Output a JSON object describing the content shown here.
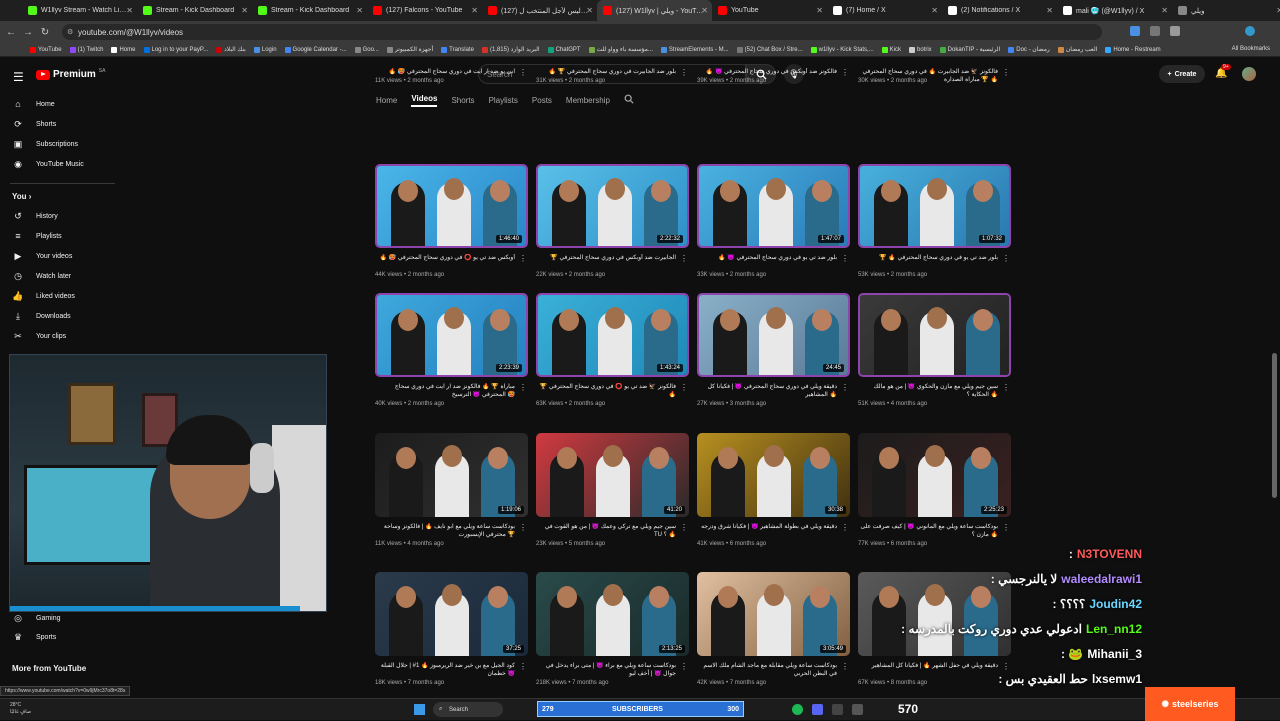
{
  "browser": {
    "tabs": [
      {
        "title": "W1llyv Stream - Watch Live c",
        "color": "#53fc18"
      },
      {
        "title": "Stream - Kick Dashboard",
        "color": "#53fc18"
      },
      {
        "title": "Stream - Kick Dashboard",
        "color": "#53fc18"
      },
      {
        "title": "(127) Falcons - YouTube",
        "color": "#ff0000"
      },
      {
        "title": "(127) كواليس لأجل المنتخب ل",
        "color": "#ff0000"
      },
      {
        "title": "(127) W1llyv | ويلي - YouTube",
        "color": "#ff0000"
      },
      {
        "title": "YouTube",
        "color": "#ff0000"
      },
      {
        "title": "(7) Home / X",
        "color": "#ffffff"
      },
      {
        "title": "(2) Notifications / X",
        "color": "#ffffff"
      },
      {
        "title": "mali 🥶 (@W1llyv) / X",
        "color": "#ffffff"
      },
      {
        "title": "ويلي",
        "color": "#888888"
      }
    ],
    "url": "youtube.com/@W1llyv/videos",
    "bookmarks": [
      "YouTube",
      "(1) Twitch",
      "Home",
      "Log in to your PayP...",
      "بنك البلاد",
      "Login",
      "Google Calendar -...",
      "Goo...",
      "أجهزة الكمبيوتر",
      "Translate",
      "البريد الوارد (1,815)",
      "ChatGPT",
      "مؤسسة باء وواو للت...",
      "StreamElements - M...",
      "(52) Chat Box / Stre...",
      "w1llyv - Kick Stats,...",
      "Kick",
      "botrix",
      "DokanTIP - الرئيسية",
      "Doc - رمضان",
      "العب رمضان",
      "Home - Restream"
    ],
    "all_bookmarks": "All Bookmarks"
  },
  "yt": {
    "logo": "Premium",
    "logo_region": "SA",
    "search_placeholder": "Search",
    "create": "Create",
    "notif_count": "9+"
  },
  "sidebar": {
    "items": [
      {
        "label": "Home",
        "icon": "⌂"
      },
      {
        "label": "Shorts",
        "icon": "⟳"
      },
      {
        "label": "Subscriptions",
        "icon": "▣"
      },
      {
        "label": "YouTube Music",
        "icon": "◉"
      }
    ],
    "you": "You",
    "you_items": [
      {
        "label": "History",
        "icon": "↺"
      },
      {
        "label": "Playlists",
        "icon": "≡"
      },
      {
        "label": "Your videos",
        "icon": "▶"
      },
      {
        "label": "Watch later",
        "icon": "◷"
      },
      {
        "label": "Liked videos",
        "icon": "👍"
      },
      {
        "label": "Downloads",
        "icon": "⤓"
      },
      {
        "label": "Your clips",
        "icon": "✂"
      }
    ],
    "explore_items": [
      {
        "label": "Gaming",
        "icon": "🎮"
      },
      {
        "label": "Sports",
        "icon": "🏆"
      }
    ],
    "more_from_youtube": "More from YouTube"
  },
  "channel_tabs": [
    "Home",
    "Videos",
    "Shorts",
    "Playlists",
    "Posts",
    "Membership"
  ],
  "videos": [
    {
      "title": "🔥 🥵 ابي يو ضد ار ايت في دوري سحاج المحترفي",
      "meta": "11K views • 2 months ago"
    },
    {
      "title": "🔥 🏆 بلور ضد الجابيرت في دوري سحاج المحترفي",
      "meta": "31K views • 2 months ago"
    },
    {
      "title": "🔥 😈 فالكونز ضد أوبكس في دوري سحاج المحترفي",
      "meta": "39K views • 2 months ago"
    },
    {
      "title": "فالكونز 🦅 ضد الجابيرت 🔥 في دوري سحاج المحترفي 🏆 مباراة الصدارة 🔥",
      "meta": "30K views • 2 months ago"
    },
    {
      "title": "🔥 🥵 أوبكس ضد تي يو ⭕ في دوري سحاج المحترفي",
      "meta": "44K views • 2 months ago",
      "dur": "1:46:40"
    },
    {
      "title": "🏆 الجابيرت ضد أوبكس في دوري سحاج المحترفي",
      "meta": "22K views • 2 months ago",
      "dur": "2:22:32"
    },
    {
      "title": "🔥 😈 بلور ضد تي يو في دوري سحاج المحترفي",
      "meta": "33K views • 2 months ago",
      "dur": "1:47:07"
    },
    {
      "title": "🏆 🔥 بلور ضد تي يو في دوري سحاج المحترفي",
      "meta": "53K views • 2 months ago",
      "dur": "1:07:32"
    },
    {
      "title": "مباراة 🏆 🔥 فالكونز ضد ار ايت في دوري سحاج المحترفي 😈 الترسيخ 🥵",
      "meta": "40K views • 2 months ago",
      "dur": "2:23:39"
    },
    {
      "title": "🏆 فالكونز 🦅 ضد تي يو ⭕ في دوري سحاج المحترفي 🔥",
      "meta": "63K views • 2 months ago",
      "dur": "1:43:24"
    },
    {
      "title": "دقيقة ويلي في دوري سحاج المحترفي 😈 | فكيانا كل المشاهير 🔥",
      "meta": "27K views • 3 months ago",
      "dur": "24:45"
    },
    {
      "title": "سين جيم ويلي مع مازن والحكوي 😈 | من هو مالك الحكاية ؟ 🔥",
      "meta": "51K views • 4 months ago",
      "dur": ""
    },
    {
      "title": "بودكاست ساعة ويلي مع ابو نايف 🔥 | فالكونز وساحة محترفي الإيسبورت 🏆",
      "meta": "11K views • 4 months ago",
      "dur": "1:19:06"
    },
    {
      "title": "سين جيم ويلي مع تركي وعمك 😈 | من هو القوت في TU ؟ 🔥",
      "meta": "23K views • 5 months ago",
      "dur": "41:20"
    },
    {
      "title": "دقيقة ويلي في بطولة المشاهير 😈 | فكيانا شرق ودرجه",
      "meta": "41K views • 6 months ago",
      "dur": "30:38"
    },
    {
      "title": "بودكاست ساعة ويلي مع المانوني 😈 | كيف صرفت على مازن ؟ 🔥",
      "meta": "77K views • 6 months ago",
      "dur": "2:25:23"
    },
    {
      "title": "كود الجيل مع بن خير ضد الريرمبوز 🔥 1# | جلال القبلة 😈 خطمان",
      "meta": "18K views • 7 months ago",
      "dur": "37:25"
    },
    {
      "title": "بودكاست ساعة ويلي مع براء 😈 | متى براء يدخل في جوال 😈 | أخف ليو",
      "meta": "218K views • 7 months ago",
      "dur": "2:13:25"
    },
    {
      "title": "بودكاست ساعة ويلي مقابلة مع ماجد الشام ملك الاسم في البطن الحربي",
      "meta": "42K views • 7 months ago",
      "dur": "3:05:49"
    },
    {
      "title": "دقيقة ويلي في حفل الشهر 🔥 | فكيانا كل المشاهير",
      "meta": "67K views • 8 months ago",
      "dur": ""
    }
  ],
  "chat": [
    {
      "user": "N3TOVENN",
      "msg": ":"
    },
    {
      "user": "waleedalrawi1",
      "msg": ": لا يالنرجسي"
    },
    {
      "user": "Joudin42",
      "msg": ": ؟؟؟؟"
    },
    {
      "user": "Len_nn12",
      "msg": ": ادعولي عدي دوري روكت بالمدرسه"
    },
    {
      "user": "Mihanii_3",
      "msg": ": 🐸"
    },
    {
      "user": "lxsemw1",
      "msg": ": حط العقيدي بس"
    }
  ],
  "taskbar": {
    "weather_temp": "28°C",
    "weather_desc": "صافٍ غالبًا",
    "search": "Search",
    "subs_current": "279",
    "subs_label": "SUBSCRIBERS",
    "subs_goal": "300",
    "brand": "steelseries",
    "extra": "570"
  },
  "status_url": "https://www.youtube.com/watch?v=0w9jMrc37o8t=28s"
}
